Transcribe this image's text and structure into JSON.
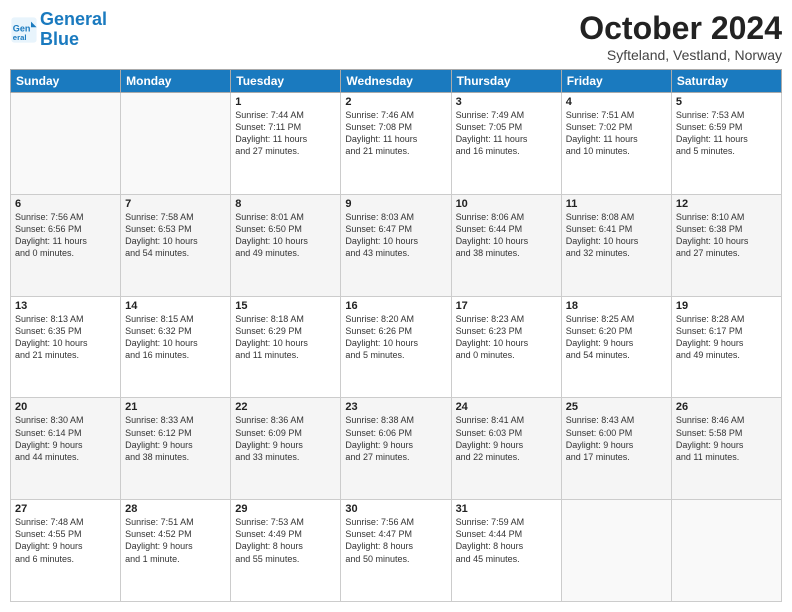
{
  "header": {
    "logo_line1": "General",
    "logo_line2": "Blue",
    "title": "October 2024",
    "subtitle": "Syfteland, Vestland, Norway"
  },
  "weekdays": [
    "Sunday",
    "Monday",
    "Tuesday",
    "Wednesday",
    "Thursday",
    "Friday",
    "Saturday"
  ],
  "weeks": [
    [
      {
        "day": "",
        "info": ""
      },
      {
        "day": "",
        "info": ""
      },
      {
        "day": "1",
        "info": "Sunrise: 7:44 AM\nSunset: 7:11 PM\nDaylight: 11 hours\nand 27 minutes."
      },
      {
        "day": "2",
        "info": "Sunrise: 7:46 AM\nSunset: 7:08 PM\nDaylight: 11 hours\nand 21 minutes."
      },
      {
        "day": "3",
        "info": "Sunrise: 7:49 AM\nSunset: 7:05 PM\nDaylight: 11 hours\nand 16 minutes."
      },
      {
        "day": "4",
        "info": "Sunrise: 7:51 AM\nSunset: 7:02 PM\nDaylight: 11 hours\nand 10 minutes."
      },
      {
        "day": "5",
        "info": "Sunrise: 7:53 AM\nSunset: 6:59 PM\nDaylight: 11 hours\nand 5 minutes."
      }
    ],
    [
      {
        "day": "6",
        "info": "Sunrise: 7:56 AM\nSunset: 6:56 PM\nDaylight: 11 hours\nand 0 minutes."
      },
      {
        "day": "7",
        "info": "Sunrise: 7:58 AM\nSunset: 6:53 PM\nDaylight: 10 hours\nand 54 minutes."
      },
      {
        "day": "8",
        "info": "Sunrise: 8:01 AM\nSunset: 6:50 PM\nDaylight: 10 hours\nand 49 minutes."
      },
      {
        "day": "9",
        "info": "Sunrise: 8:03 AM\nSunset: 6:47 PM\nDaylight: 10 hours\nand 43 minutes."
      },
      {
        "day": "10",
        "info": "Sunrise: 8:06 AM\nSunset: 6:44 PM\nDaylight: 10 hours\nand 38 minutes."
      },
      {
        "day": "11",
        "info": "Sunrise: 8:08 AM\nSunset: 6:41 PM\nDaylight: 10 hours\nand 32 minutes."
      },
      {
        "day": "12",
        "info": "Sunrise: 8:10 AM\nSunset: 6:38 PM\nDaylight: 10 hours\nand 27 minutes."
      }
    ],
    [
      {
        "day": "13",
        "info": "Sunrise: 8:13 AM\nSunset: 6:35 PM\nDaylight: 10 hours\nand 21 minutes."
      },
      {
        "day": "14",
        "info": "Sunrise: 8:15 AM\nSunset: 6:32 PM\nDaylight: 10 hours\nand 16 minutes."
      },
      {
        "day": "15",
        "info": "Sunrise: 8:18 AM\nSunset: 6:29 PM\nDaylight: 10 hours\nand 11 minutes."
      },
      {
        "day": "16",
        "info": "Sunrise: 8:20 AM\nSunset: 6:26 PM\nDaylight: 10 hours\nand 5 minutes."
      },
      {
        "day": "17",
        "info": "Sunrise: 8:23 AM\nSunset: 6:23 PM\nDaylight: 10 hours\nand 0 minutes."
      },
      {
        "day": "18",
        "info": "Sunrise: 8:25 AM\nSunset: 6:20 PM\nDaylight: 9 hours\nand 54 minutes."
      },
      {
        "day": "19",
        "info": "Sunrise: 8:28 AM\nSunset: 6:17 PM\nDaylight: 9 hours\nand 49 minutes."
      }
    ],
    [
      {
        "day": "20",
        "info": "Sunrise: 8:30 AM\nSunset: 6:14 PM\nDaylight: 9 hours\nand 44 minutes."
      },
      {
        "day": "21",
        "info": "Sunrise: 8:33 AM\nSunset: 6:12 PM\nDaylight: 9 hours\nand 38 minutes."
      },
      {
        "day": "22",
        "info": "Sunrise: 8:36 AM\nSunset: 6:09 PM\nDaylight: 9 hours\nand 33 minutes."
      },
      {
        "day": "23",
        "info": "Sunrise: 8:38 AM\nSunset: 6:06 PM\nDaylight: 9 hours\nand 27 minutes."
      },
      {
        "day": "24",
        "info": "Sunrise: 8:41 AM\nSunset: 6:03 PM\nDaylight: 9 hours\nand 22 minutes."
      },
      {
        "day": "25",
        "info": "Sunrise: 8:43 AM\nSunset: 6:00 PM\nDaylight: 9 hours\nand 17 minutes."
      },
      {
        "day": "26",
        "info": "Sunrise: 8:46 AM\nSunset: 5:58 PM\nDaylight: 9 hours\nand 11 minutes."
      }
    ],
    [
      {
        "day": "27",
        "info": "Sunrise: 7:48 AM\nSunset: 4:55 PM\nDaylight: 9 hours\nand 6 minutes."
      },
      {
        "day": "28",
        "info": "Sunrise: 7:51 AM\nSunset: 4:52 PM\nDaylight: 9 hours\nand 1 minute."
      },
      {
        "day": "29",
        "info": "Sunrise: 7:53 AM\nSunset: 4:49 PM\nDaylight: 8 hours\nand 55 minutes."
      },
      {
        "day": "30",
        "info": "Sunrise: 7:56 AM\nSunset: 4:47 PM\nDaylight: 8 hours\nand 50 minutes."
      },
      {
        "day": "31",
        "info": "Sunrise: 7:59 AM\nSunset: 4:44 PM\nDaylight: 8 hours\nand 45 minutes."
      },
      {
        "day": "",
        "info": ""
      },
      {
        "day": "",
        "info": ""
      }
    ]
  ]
}
